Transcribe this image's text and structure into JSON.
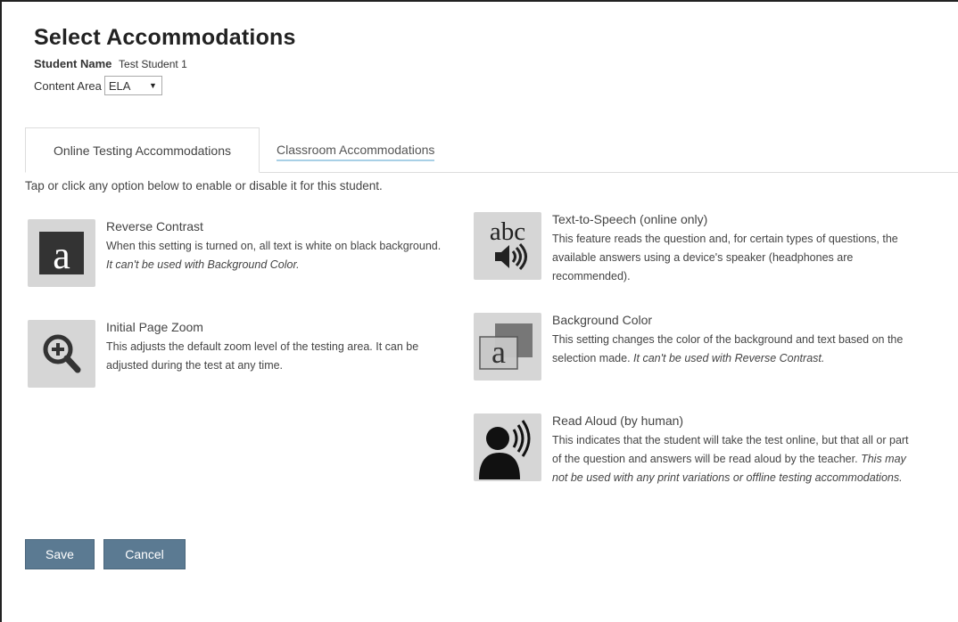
{
  "header": {
    "title": "Select Accommodations",
    "student_name_label": "Student Name",
    "student_name_value": "Test Student 1",
    "content_area_label": "Content Area",
    "content_area_value": "ELA"
  },
  "tabs": [
    {
      "label": "Online Testing Accommodations",
      "active": true
    },
    {
      "label": "Classroom Accommodations",
      "active": false
    }
  ],
  "instructions": "Tap or click any option below to enable or disable it for this student.",
  "options": {
    "reverse_contrast": {
      "title": "Reverse Contrast",
      "desc": "When this setting is turned on, all text is white on black background.",
      "note": "It can't be used with Background Color.",
      "icon": "reverse-contrast-icon"
    },
    "initial_page_zoom": {
      "title": "Initial Page Zoom",
      "desc": "This adjusts the default zoom level of the testing area. It can be adjusted during the test at any time.",
      "icon": "zoom-icon"
    },
    "text_to_speech": {
      "title": "Text-to-Speech (online only)",
      "desc": "This feature reads the question and, for certain types of questions, the available answers using a device's speaker (headphones are recommended).",
      "icon": "text-to-speech-icon",
      "icon_text": "abc"
    },
    "background_color": {
      "title": "Background Color",
      "desc": "This setting changes the color of the background and text based on the selection made.",
      "note": "It can't be used with Reverse Contrast.",
      "icon": "background-color-icon"
    },
    "read_aloud": {
      "title": "Read Aloud (by human)",
      "desc": "This indicates that the student will take the test online, but that all or part of the question and answers will be read aloud by the teacher.",
      "note": "This may not be used with any print variations or offline testing accommodations.",
      "icon": "read-aloud-icon"
    }
  },
  "buttons": {
    "save": "Save",
    "cancel": "Cancel"
  },
  "colors": {
    "button_bg": "#5b7a92",
    "icon_tile_bg": "#d6d6d6",
    "tab_underline": "#a8d0e6"
  }
}
